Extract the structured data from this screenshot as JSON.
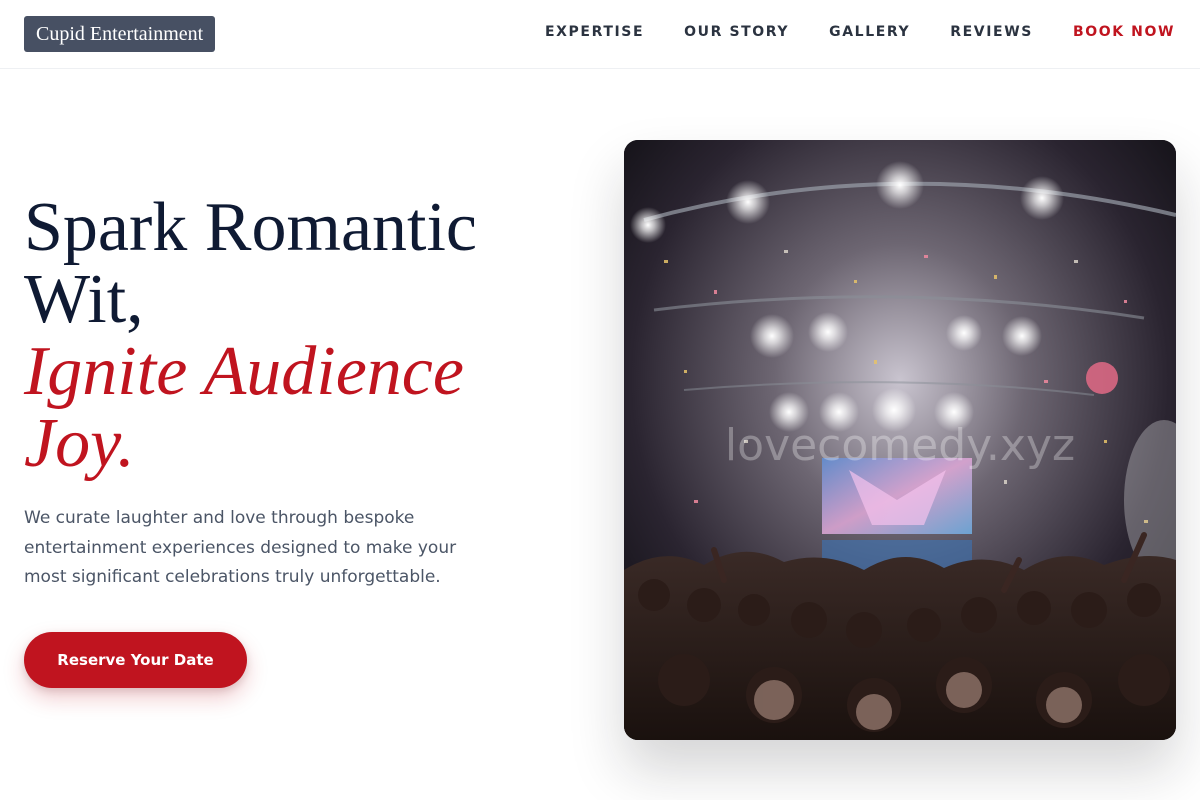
{
  "brand": {
    "name": "Cupid Entertainment"
  },
  "nav": {
    "items": [
      "EXPERTISE",
      "OUR STORY",
      "GALLERY",
      "REVIEWS"
    ],
    "book_now": "BOOK NOW"
  },
  "hero": {
    "headline_line1": "Spark Romantic",
    "headline_line2": "Wit,",
    "headline_accent_line1": "Ignite Audience",
    "headline_accent_line2": "Joy.",
    "lead": "We curate laughter and love through bespoke entertainment experiences designed to make your most significant celebrations truly unforgettable.",
    "cta_label": "Reserve Your Date",
    "image_watermark": "lovecomedy.xyz"
  },
  "colors": {
    "accent": "#c0141f",
    "headline": "#0f1a33",
    "logo_bg": "#475063",
    "body_text": "#4b5566"
  }
}
